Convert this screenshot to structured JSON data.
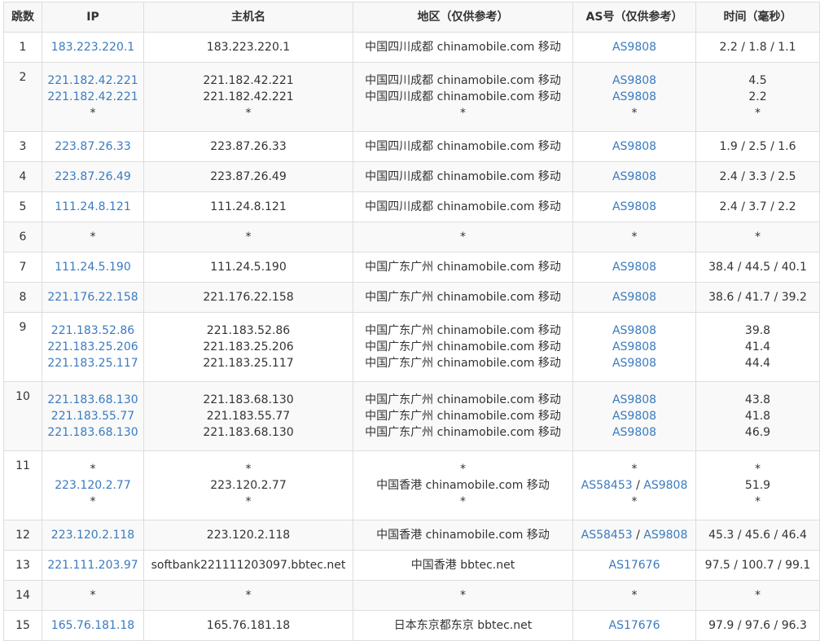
{
  "header": {
    "hop": "跳数",
    "ip": "IP",
    "hostname": "主机名",
    "region": "地区（仅供参考）",
    "as": "AS号（仅供参考）",
    "time": "时间（毫秒）"
  },
  "rows": [
    {
      "hop": "1",
      "ip": [
        "183.223.220.1"
      ],
      "host": [
        "183.223.220.1"
      ],
      "region": [
        "中国四川成都 chinamobile.com 移动"
      ],
      "as": [
        [
          "AS9808"
        ]
      ],
      "time": [
        "2.2 / 1.8 / 1.1"
      ]
    },
    {
      "hop": "2",
      "ip": [
        "221.182.42.221",
        "221.182.42.221",
        "*"
      ],
      "host": [
        "221.182.42.221",
        "221.182.42.221",
        "*"
      ],
      "region": [
        "中国四川成都 chinamobile.com 移动",
        "中国四川成都 chinamobile.com 移动",
        "*"
      ],
      "as": [
        [
          "AS9808"
        ],
        [
          "AS9808"
        ],
        [
          "*"
        ]
      ],
      "time": [
        "4.5",
        "2.2",
        "*"
      ]
    },
    {
      "hop": "3",
      "ip": [
        "223.87.26.33"
      ],
      "host": [
        "223.87.26.33"
      ],
      "region": [
        "中国四川成都 chinamobile.com 移动"
      ],
      "as": [
        [
          "AS9808"
        ]
      ],
      "time": [
        "1.9 / 2.5 / 1.6"
      ]
    },
    {
      "hop": "4",
      "ip": [
        "223.87.26.49"
      ],
      "host": [
        "223.87.26.49"
      ],
      "region": [
        "中国四川成都 chinamobile.com 移动"
      ],
      "as": [
        [
          "AS9808"
        ]
      ],
      "time": [
        "2.4 / 3.3 / 2.5"
      ]
    },
    {
      "hop": "5",
      "ip": [
        "111.24.8.121"
      ],
      "host": [
        "111.24.8.121"
      ],
      "region": [
        "中国四川成都 chinamobile.com 移动"
      ],
      "as": [
        [
          "AS9808"
        ]
      ],
      "time": [
        "2.4 / 3.7 / 2.2"
      ]
    },
    {
      "hop": "6",
      "ip": [
        "*"
      ],
      "host": [
        "*"
      ],
      "region": [
        "*"
      ],
      "as": [
        [
          "*"
        ]
      ],
      "time": [
        "*"
      ]
    },
    {
      "hop": "7",
      "ip": [
        "111.24.5.190"
      ],
      "host": [
        "111.24.5.190"
      ],
      "region": [
        "中国广东广州 chinamobile.com 移动"
      ],
      "as": [
        [
          "AS9808"
        ]
      ],
      "time": [
        "38.4 / 44.5 / 40.1"
      ]
    },
    {
      "hop": "8",
      "ip": [
        "221.176.22.158"
      ],
      "host": [
        "221.176.22.158"
      ],
      "region": [
        "中国广东广州 chinamobile.com 移动"
      ],
      "as": [
        [
          "AS9808"
        ]
      ],
      "time": [
        "38.6 / 41.7 / 39.2"
      ]
    },
    {
      "hop": "9",
      "ip": [
        "221.183.52.86",
        "221.183.25.206",
        "221.183.25.117"
      ],
      "host": [
        "221.183.52.86",
        "221.183.25.206",
        "221.183.25.117"
      ],
      "region": [
        "中国广东广州 chinamobile.com 移动",
        "中国广东广州 chinamobile.com 移动",
        "中国广东广州 chinamobile.com 移动"
      ],
      "as": [
        [
          "AS9808"
        ],
        [
          "AS9808"
        ],
        [
          "AS9808"
        ]
      ],
      "time": [
        "39.8",
        "41.4",
        "44.4"
      ]
    },
    {
      "hop": "10",
      "ip": [
        "221.183.68.130",
        "221.183.55.77",
        "221.183.68.130"
      ],
      "host": [
        "221.183.68.130",
        "221.183.55.77",
        "221.183.68.130"
      ],
      "region": [
        "中国广东广州 chinamobile.com 移动",
        "中国广东广州 chinamobile.com 移动",
        "中国广东广州 chinamobile.com 移动"
      ],
      "as": [
        [
          "AS9808"
        ],
        [
          "AS9808"
        ],
        [
          "AS9808"
        ]
      ],
      "time": [
        "43.8",
        "41.8",
        "46.9"
      ]
    },
    {
      "hop": "11",
      "ip": [
        "*",
        "223.120.2.77",
        "*"
      ],
      "host": [
        "*",
        "223.120.2.77",
        "*"
      ],
      "region": [
        "*",
        "中国香港 chinamobile.com 移动",
        "*"
      ],
      "as": [
        [
          "*"
        ],
        [
          "AS58453",
          "AS9808"
        ],
        [
          "*"
        ]
      ],
      "time": [
        "*",
        "51.9",
        "*"
      ]
    },
    {
      "hop": "12",
      "ip": [
        "223.120.2.118"
      ],
      "host": [
        "223.120.2.118"
      ],
      "region": [
        "中国香港 chinamobile.com 移动"
      ],
      "as": [
        [
          "AS58453",
          "AS9808"
        ]
      ],
      "time": [
        "45.3 / 45.6 / 46.4"
      ]
    },
    {
      "hop": "13",
      "ip": [
        "221.111.203.97"
      ],
      "host": [
        "softbank221111203097.bbtec.net"
      ],
      "region": [
        "中国香港 bbtec.net"
      ],
      "as": [
        [
          "AS17676"
        ]
      ],
      "time": [
        "97.5 / 100.7 / 99.1"
      ]
    },
    {
      "hop": "14",
      "ip": [
        "*"
      ],
      "host": [
        "*"
      ],
      "region": [
        "*"
      ],
      "as": [
        [
          "*"
        ]
      ],
      "time": [
        "*"
      ]
    },
    {
      "hop": "15",
      "ip": [
        "165.76.181.18"
      ],
      "host": [
        "165.76.181.18"
      ],
      "region": [
        "日本东京都东京 bbtec.net"
      ],
      "as": [
        [
          "AS17676"
        ]
      ],
      "time": [
        "97.9 / 97.6 / 96.3"
      ]
    }
  ],
  "colors": {
    "link": "#3a7bbf",
    "border": "#dddddd",
    "header_bg": "#f8f8f8",
    "alt_row_bg": "#f9f9f9"
  }
}
